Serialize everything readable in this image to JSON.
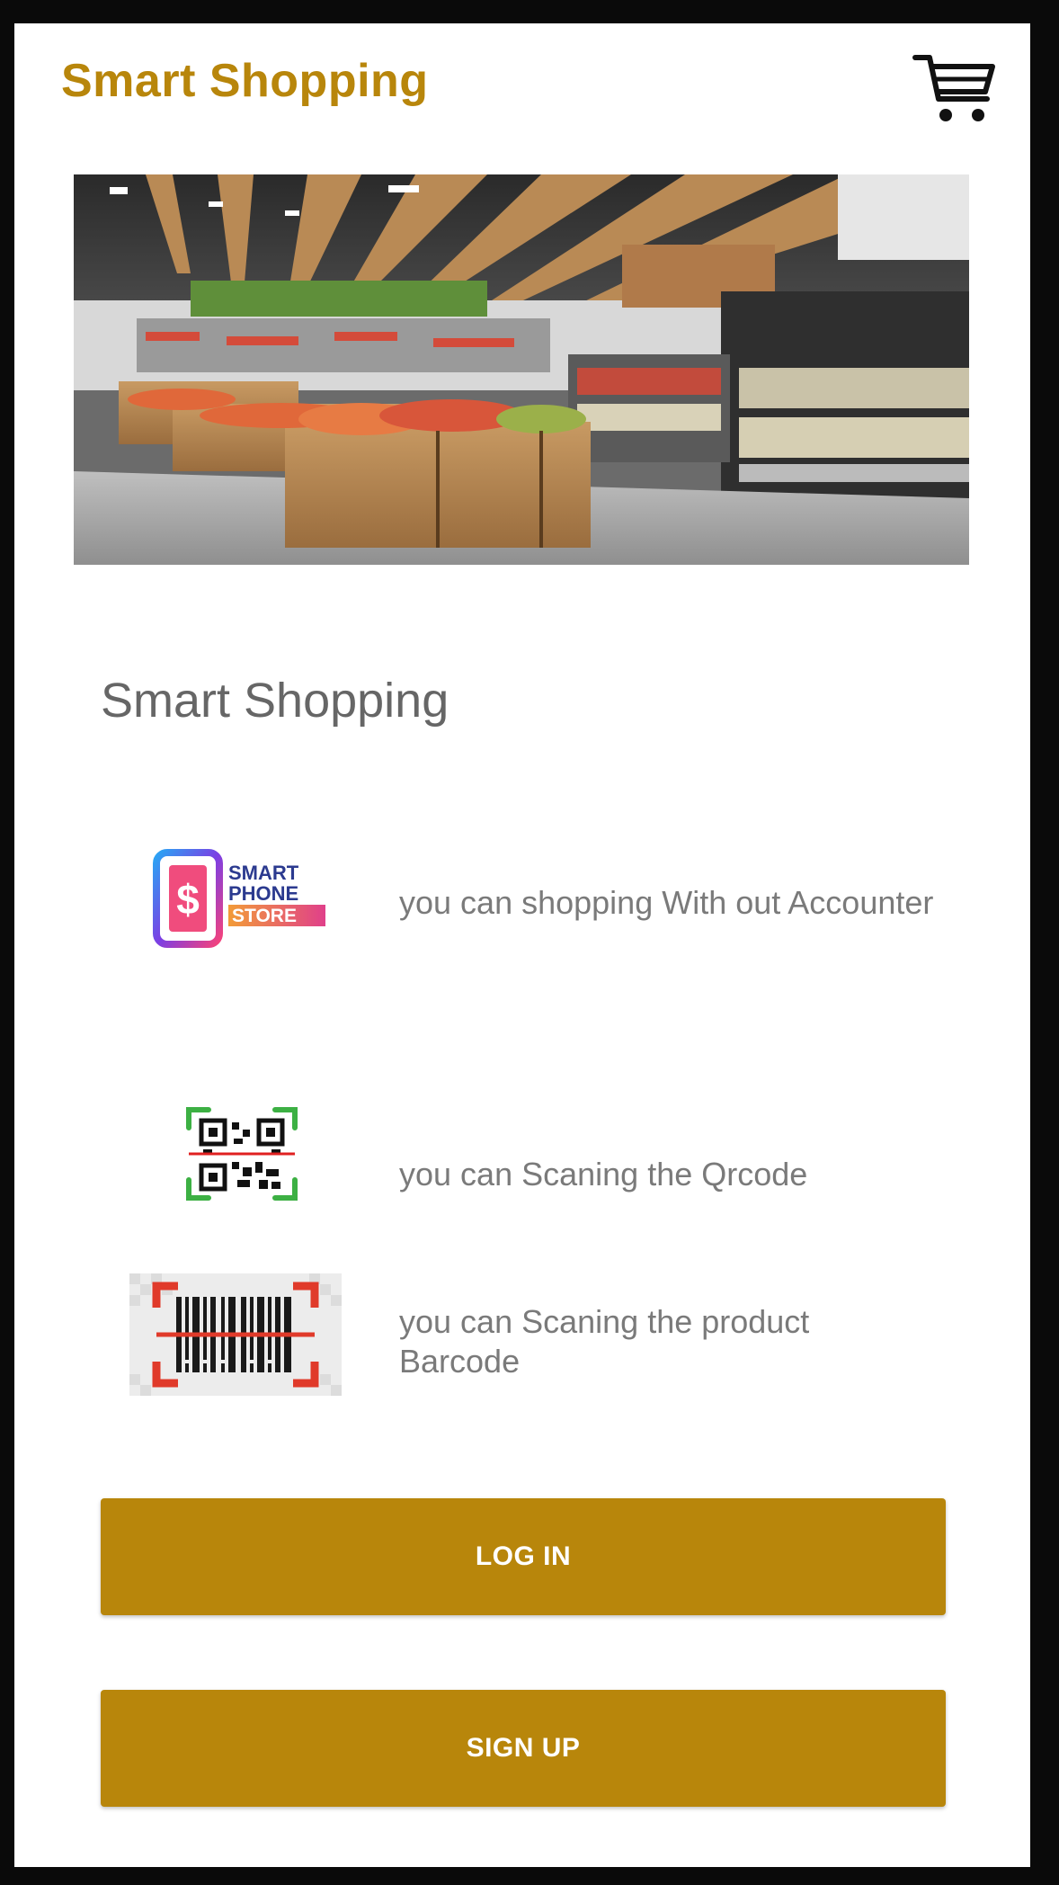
{
  "app_bar": {
    "title": "Smart Shopping",
    "cart_icon": "shopping-cart-icon"
  },
  "hero": {
    "image": "supermarket-interior-photo"
  },
  "main": {
    "section_title": "Smart Shopping",
    "features": [
      {
        "icon": "smart-phone-store-logo",
        "logo_text": [
          "SMART",
          "PHONE",
          "STORE"
        ],
        "text": "you can shopping With out Accounter"
      },
      {
        "icon": "qr-code-scan-icon",
        "text": "you can Scaning the Qrcode"
      },
      {
        "icon": "barcode-scan-icon",
        "text": "you can Scaning the product Barcode"
      }
    ]
  },
  "actions": {
    "login_label": "LOG IN",
    "signup_label": "SIGN UP"
  },
  "colors": {
    "accent": "#b8860b",
    "text_muted": "#7a7a7a",
    "title_gray": "#666666"
  }
}
